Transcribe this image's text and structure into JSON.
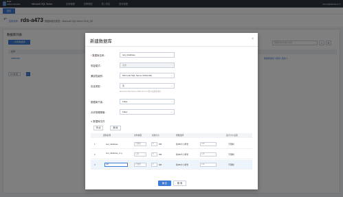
{
  "topbar": {
    "brand_line1": "Data",
    "brand_line2": "Admin Service",
    "product": "Microsoft SQL Server",
    "nav": [
      "实例管理",
      "告警管理",
      "导入导出",
      "账号管理"
    ],
    "user": "naomi@datastore"
  },
  "tab": {
    "label": "首页"
  },
  "header": {
    "instance_label": "实例名称：",
    "instance_name": "rds-a473",
    "breadcrumb": "数据库服务类型：Microsoft SQL Server 2016_SE"
  },
  "panel": {
    "title": "数据库列表",
    "add_label": "+ 新增数据库",
    "search_placeholder": "数据库名称/用户名称",
    "table_header": "名称",
    "row_name": "database",
    "row_ops": "数据库备份 | 修改 | 更多 ▾",
    "page_size": "10 条/页",
    "prev": "<",
    "page": "1",
    "next": ">"
  },
  "modal": {
    "title": "新建数据库",
    "close": "×",
    "fields": [
      {
        "label": "数据库名称：",
        "required": true,
        "value": "test_database",
        "disabled": false,
        "select": false
      },
      {
        "label": "恢复模式：",
        "required": false,
        "value": "完整",
        "disabled": true,
        "select": false
      },
      {
        "label": "兼容性级别：",
        "required": false,
        "value": "Microsoft SQL Server 2016(130)",
        "disabled": false,
        "select": true
      },
      {
        "label": "包含类型：",
        "required": false,
        "value": "无",
        "disabled": false,
        "select": true,
        "hint": "Microsoft SQL Server 2016 (13.x) 以及以后版本支持"
      },
      {
        "label": "数据库只读：",
        "required": false,
        "value": "False",
        "disabled": false,
        "select": true
      },
      {
        "label": "允许快照隔离：",
        "required": false,
        "value": "False",
        "disabled": false,
        "select": true
      }
    ],
    "files_title": "∨ 数据库文件",
    "add_btn": "添 加",
    "delete_btn": "删 除",
    "file_cols": [
      "逻辑名称",
      "文件类型",
      "初始大小",
      "增量选择",
      "最大大小设置"
    ],
    "files": [
      {
        "idx": "1",
        "name": "test_database",
        "type": "行数据",
        "size": "8",
        "unit": "MB",
        "growth": "按MB大小增长",
        "growth_val": "128",
        "max": "不限制"
      },
      {
        "idx": "2",
        "name": "test_database_lo g",
        "type": "日志",
        "size": "8",
        "unit": "MB",
        "growth": "按MB大小增长",
        "growth_val": "128",
        "max": "不限制"
      },
      {
        "idx": "3",
        "name": "ndf",
        "type": "行数据",
        "size": "8",
        "unit": "MB",
        "growth": "按MB大小增长",
        "growth_val": "128",
        "max": "不限制"
      }
    ],
    "ok": "确 定",
    "cancel": "取 消"
  }
}
